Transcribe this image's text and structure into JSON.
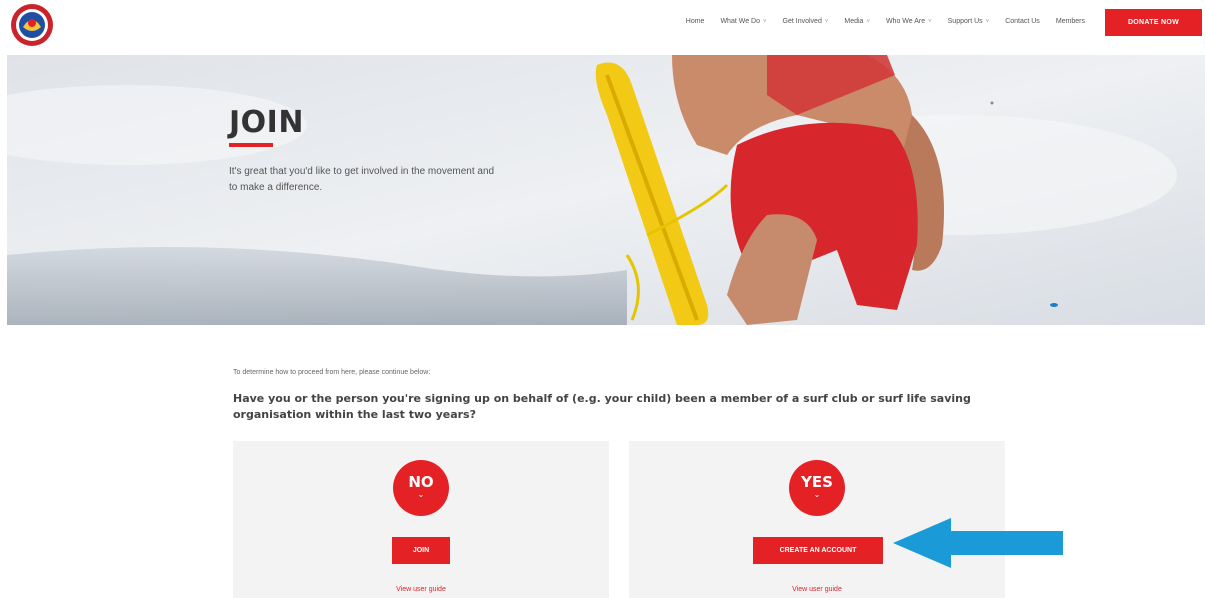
{
  "header": {
    "logo": "club-crest-logo",
    "nav": [
      "Home",
      "What We Do",
      "Get Involved",
      "Media",
      "Who We Are",
      "Support Us",
      "Contact Us",
      "Members"
    ],
    "nav_dropdowns": [
      false,
      true,
      true,
      true,
      true,
      true,
      false,
      false
    ],
    "donate_label": "DONATE NOW"
  },
  "hero": {
    "title": "JOIN",
    "text": "It's great that you'd like to get involved in the movement and to make a difference."
  },
  "content": {
    "intro": "To determine how to proceed from here, please continue below:",
    "question": "Have you or the person you're signing up on behalf of (e.g. your child) been a member of a surf club or surf life saving organisation within the last two years?",
    "options": {
      "no": {
        "badge": "NO",
        "chevron": "⌄",
        "button": "JOIN",
        "guide": "View user guide"
      },
      "yes": {
        "badge": "YES",
        "chevron": "⌄",
        "button": "CREATE AN ACCOUNT",
        "guide": "View user guide"
      }
    }
  },
  "colors": {
    "accent": "#e42226",
    "card_bg": "#f3f3f3",
    "arrow": "#1a9ad6"
  }
}
